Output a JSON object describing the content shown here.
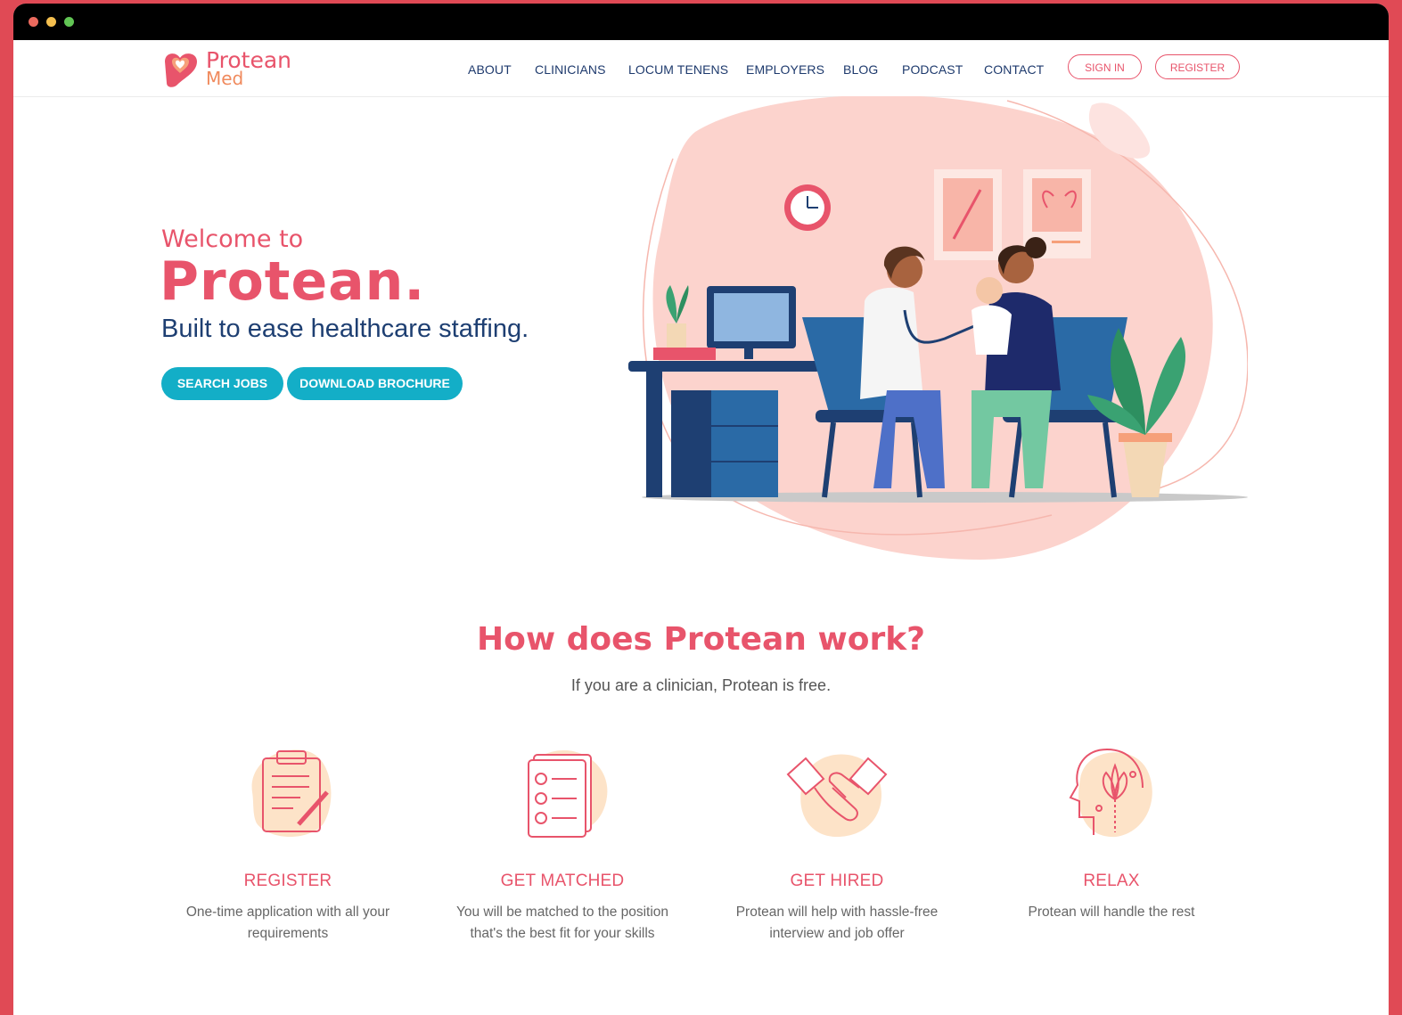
{
  "brand": {
    "name": "Protean",
    "sub": "Med"
  },
  "nav": {
    "items": [
      "ABOUT",
      "CLINICIANS",
      "LOCUM TENENS",
      "EMPLOYERS",
      "BLOG",
      "PODCAST",
      "CONTACT"
    ],
    "sign_in": "SIGN IN",
    "register": "REGISTER"
  },
  "hero": {
    "welcome": "Welcome to",
    "brand": "Protean.",
    "tagline": "Built to ease healthcare staffing.",
    "search_jobs": "SEARCH JOBS",
    "download_brochure": "DOWNLOAD BROCHURE"
  },
  "how": {
    "title": "How does Protean work?",
    "subtitle": "If you are a clinician, Protean is free.",
    "steps": [
      {
        "title": "REGISTER",
        "desc_line1": "One-time application with all your",
        "desc_line2": "requirements",
        "icon": "clipboard-icon"
      },
      {
        "title": "GET MATCHED",
        "desc_line1": "You will be matched to the position",
        "desc_line2": "that's the best fit for your skills",
        "icon": "checklist-icon"
      },
      {
        "title": "GET HIRED",
        "desc_line1": "Protean will help with hassle-free",
        "desc_line2": "interview and job offer",
        "icon": "handshake-icon"
      },
      {
        "title": "RELAX",
        "desc_line1": "Protean will handle the rest",
        "desc_line2": "",
        "icon": "mind-lotus-icon"
      }
    ]
  },
  "colors": {
    "accent": "#e8546b",
    "navy": "#1e3f72",
    "teal": "#13aec7",
    "frame": "#e04a55",
    "blob": "#fcd3cd",
    "icon_bg": "#fde3c8"
  }
}
